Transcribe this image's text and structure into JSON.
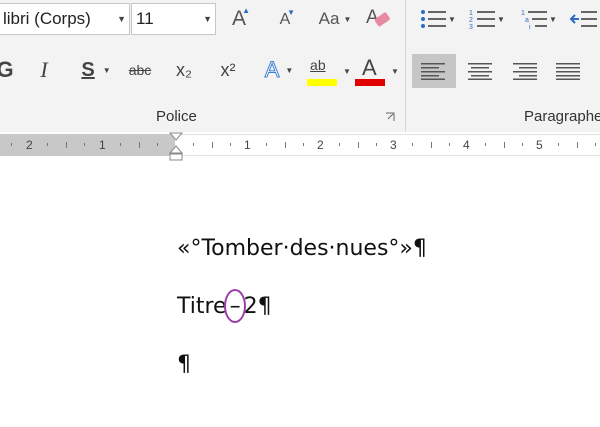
{
  "ribbon": {
    "font_name": "libri (Corps)",
    "font_size": "11",
    "grow_font_icon": "A",
    "shrink_font_icon": "A",
    "change_case_label": "Aa",
    "bold_label": "G",
    "italic_label": "I",
    "underline_label": "S",
    "strikethrough_label": "abc",
    "subscript_label": "x₂",
    "superscript_label": "x²",
    "text_effects_label": "A",
    "highlight_label": "ab",
    "font_color_label": "A",
    "police_group_label": "Police",
    "paragraph_group_label": "Paragraphe",
    "highlight_color": "#ffff00",
    "font_color": "#e00000"
  },
  "ruler": {
    "left_numbers": [
      "2",
      "1"
    ],
    "right_numbers": [
      "1",
      "2",
      "3",
      "4",
      "5"
    ]
  },
  "document": {
    "line1": "«°Tomber·des·nues°»¶",
    "line2_part1": "Titre",
    "line2_mark": "–",
    "line2_part2": "2¶",
    "line3": "¶",
    "annotation_color": "#9b3fa6"
  }
}
